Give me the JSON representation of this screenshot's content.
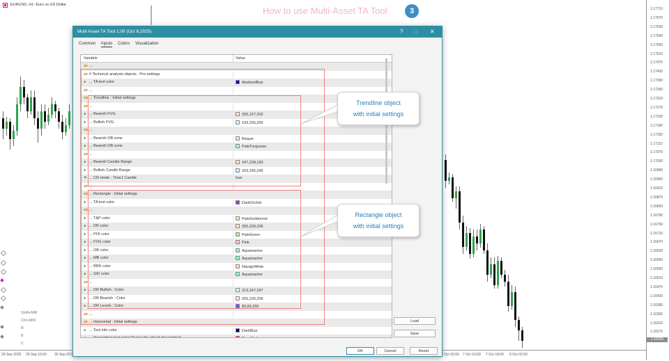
{
  "chart": {
    "symbol": "EURUSD, H1: Euro vs US Dollar",
    "price_labels": [
      "1.17710",
      "1.17670",
      "1.17630",
      "1.17590",
      "1.17550",
      "1.17510",
      "1.17470",
      "1.17430",
      "1.17390",
      "1.17350",
      "1.17310",
      "1.17270",
      "1.17230",
      "1.17190",
      "1.17150",
      "1.17110",
      "1.17070",
      "1.17030",
      "1.16990",
      "1.16950",
      "1.16910",
      "1.16870",
      "1.16830",
      "1.16790",
      "1.16750",
      "1.16710",
      "1.16670",
      "1.16630",
      "1.16590",
      "1.16550",
      "1.16510",
      "1.16470",
      "1.16430",
      "1.16390",
      "1.16350",
      "1.16310",
      "1.16270"
    ],
    "current_price": "1.16283",
    "time_labels": [
      "29 Sep 2025",
      "29 Sep 10:00",
      "30 Sep 02:00",
      "7 Oct 02:00",
      "7 Oct 10:00",
      "7 Oct 18:00",
      "8 Oct 02:00"
    ],
    "side_keys": [
      "Shift+MM",
      "Ctrl+MM",
      "R",
      "B",
      "C"
    ]
  },
  "hud": {
    "title": "How to use Multi-Asset TA Tool",
    "badge": "3"
  },
  "dialog": {
    "title": "Multi Asset TA Tool 1.00 (Oct 8,2025)",
    "tabs": [
      {
        "label": "Common",
        "active": false
      },
      {
        "label": "Inputs",
        "active": true
      },
      {
        "label": "Colors",
        "active": false
      },
      {
        "label": "Visualization",
        "active": false
      }
    ],
    "columns": {
      "variable": "Variable",
      "value": "Value"
    },
    "rows": [
      {
        "icon": "ab",
        "name": "...",
        "value": ""
      },
      {
        "icon": "ab",
        "name": "# Technical analysis objects : Pre-settings",
        "value": ""
      },
      {
        "icon": "clr",
        "name": "... TA text color",
        "value": "MediumBlue",
        "swatch": "#0000cd"
      },
      {
        "icon": "ab",
        "name": "...",
        "value": ""
      },
      {
        "icon": "ab",
        "name": "... Trendline : Initial settings",
        "value": ""
      },
      {
        "icon": "ab",
        "name": "...",
        "value": ""
      },
      {
        "icon": "clr",
        "name": "... Bearish FVG",
        "value": "255,227,202",
        "swatch": "#ffe3ca"
      },
      {
        "icon": "clr",
        "name": "... Bullish FVG",
        "value": "193,255,255",
        "swatch": "#c1ffff"
      },
      {
        "icon": "ab",
        "name": "...",
        "value": ""
      },
      {
        "icon": "clr",
        "name": "... Bearish OB zone",
        "value": "Bisque",
        "swatch": "#ffe4c4"
      },
      {
        "icon": "clr",
        "name": "... Bearish OB zone",
        "value": "PaleTurquoise",
        "swatch": "#afeeee"
      },
      {
        "icon": "ab",
        "name": "...",
        "value": ""
      },
      {
        "icon": "clr",
        "name": "... Bearish Candle Range",
        "value": "247,228,193",
        "swatch": "#f7e4c1"
      },
      {
        "icon": "clr",
        "name": "... Bullish Candle Range",
        "value": "203,245,245",
        "swatch": "#cbf5f5"
      },
      {
        "icon": "flag",
        "name": "... CR mode : Time1 Candle",
        "value": "true"
      },
      {
        "icon": "ab",
        "name": "...",
        "value": ""
      },
      {
        "icon": "ab",
        "name": "... Rectangle : Initial settings",
        "value": ""
      },
      {
        "icon": "clr",
        "name": "... TA text color",
        "value": "DarkOrchid",
        "swatch": "#9932cc"
      },
      {
        "icon": "ab",
        "name": "...",
        "value": ""
      },
      {
        "icon": "clr",
        "name": "... T&P color",
        "value": "PaleGoldenrod",
        "swatch": "#eee8aa"
      },
      {
        "icon": "clr",
        "name": "... DR color",
        "value": "255,230,206",
        "swatch": "#ffe6ce"
      },
      {
        "icon": "clr",
        "name": "... POI color",
        "value": "PaleGreen",
        "swatch": "#98fb98"
      },
      {
        "icon": "clr",
        "name": "... FVG color",
        "value": "Pink",
        "swatch": "#ffc0cb"
      },
      {
        "icon": "clr",
        "name": "... OB color",
        "value": "Aquamarine",
        "swatch": "#7fffd4"
      },
      {
        "icon": "clr",
        "name": "... MB color",
        "value": "Aquamarine",
        "swatch": "#7fffd4"
      },
      {
        "icon": "clr",
        "name": "... BRK color",
        "value": "NavajoWhite",
        "swatch": "#ffdead"
      },
      {
        "icon": "clr",
        "name": "... S/D color",
        "value": "Aquamarine",
        "swatch": "#7fffd4"
      },
      {
        "icon": "ab",
        "name": "...",
        "value": ""
      },
      {
        "icon": "clr",
        "name": "... DR Bullish : Color",
        "value": "213,247,247",
        "swatch": "#d5f7f7"
      },
      {
        "icon": "clr",
        "name": "... DR Bearish : Color",
        "value": "255,230,206",
        "swatch": "#ffe6ce"
      },
      {
        "icon": "clr",
        "name": "... DR Levels : Color",
        "value": "89,89,255",
        "swatch": "#5959ff"
      },
      {
        "icon": "ab",
        "name": "...",
        "value": ""
      },
      {
        "icon": "ab",
        "name": "... Horizontal : Initial settings",
        "value": ""
      },
      {
        "icon": "clr",
        "name": "... Text info color",
        "value": "DarkBlue",
        "swatch": "#00008b"
      },
      {
        "icon": "clr",
        "name": "... Description text color [Text in the object description]",
        "value": "DeepPink",
        "swatch": "#ff1493"
      }
    ],
    "side_buttons": {
      "load": "Load",
      "save": "Save"
    },
    "footer_buttons": {
      "ok": "OK",
      "cancel": "Cancel",
      "reset": "Reset"
    }
  },
  "annotations": {
    "trendline_callout": "Trendline object\nwith initial settings",
    "rectangle_callout": "Rectangle object\nwith initial settings",
    "highlight_color": "#f08080"
  }
}
